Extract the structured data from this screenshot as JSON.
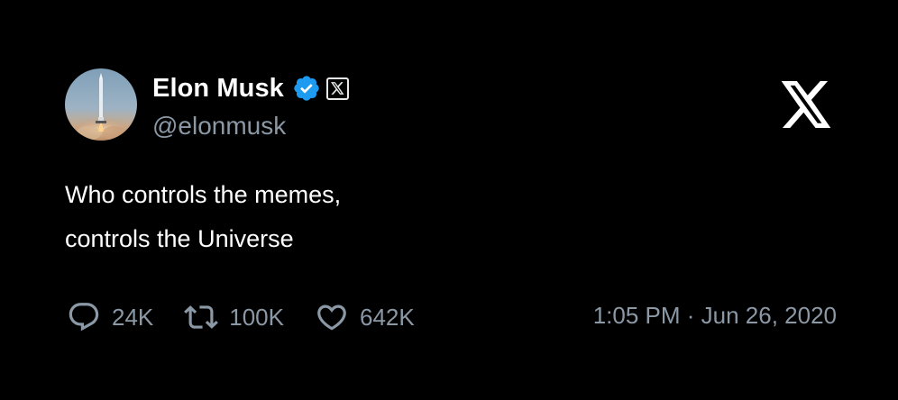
{
  "author": {
    "display_name": "Elon Musk",
    "handle": "@elonmusk",
    "verified": true,
    "verified_color": "#1d9bf0",
    "affiliation_badge_icon": "x-logo-icon",
    "avatar_icon": "rocket-launch-avatar"
  },
  "brand": {
    "logo_icon": "x-logo-icon"
  },
  "tweet": {
    "lines": [
      "Who controls the memes,",
      "controls the Universe"
    ]
  },
  "actions": {
    "replies": {
      "icon": "reply-icon",
      "count": "24K"
    },
    "reposts": {
      "icon": "repost-icon",
      "count": "100K"
    },
    "likes": {
      "icon": "like-icon",
      "count": "642K"
    }
  },
  "timestamp": "1:05 PM · Jun 26, 2020",
  "colors": {
    "background": "#000000",
    "primary_text": "#ffffff",
    "secondary_text": "#8b98a5"
  }
}
